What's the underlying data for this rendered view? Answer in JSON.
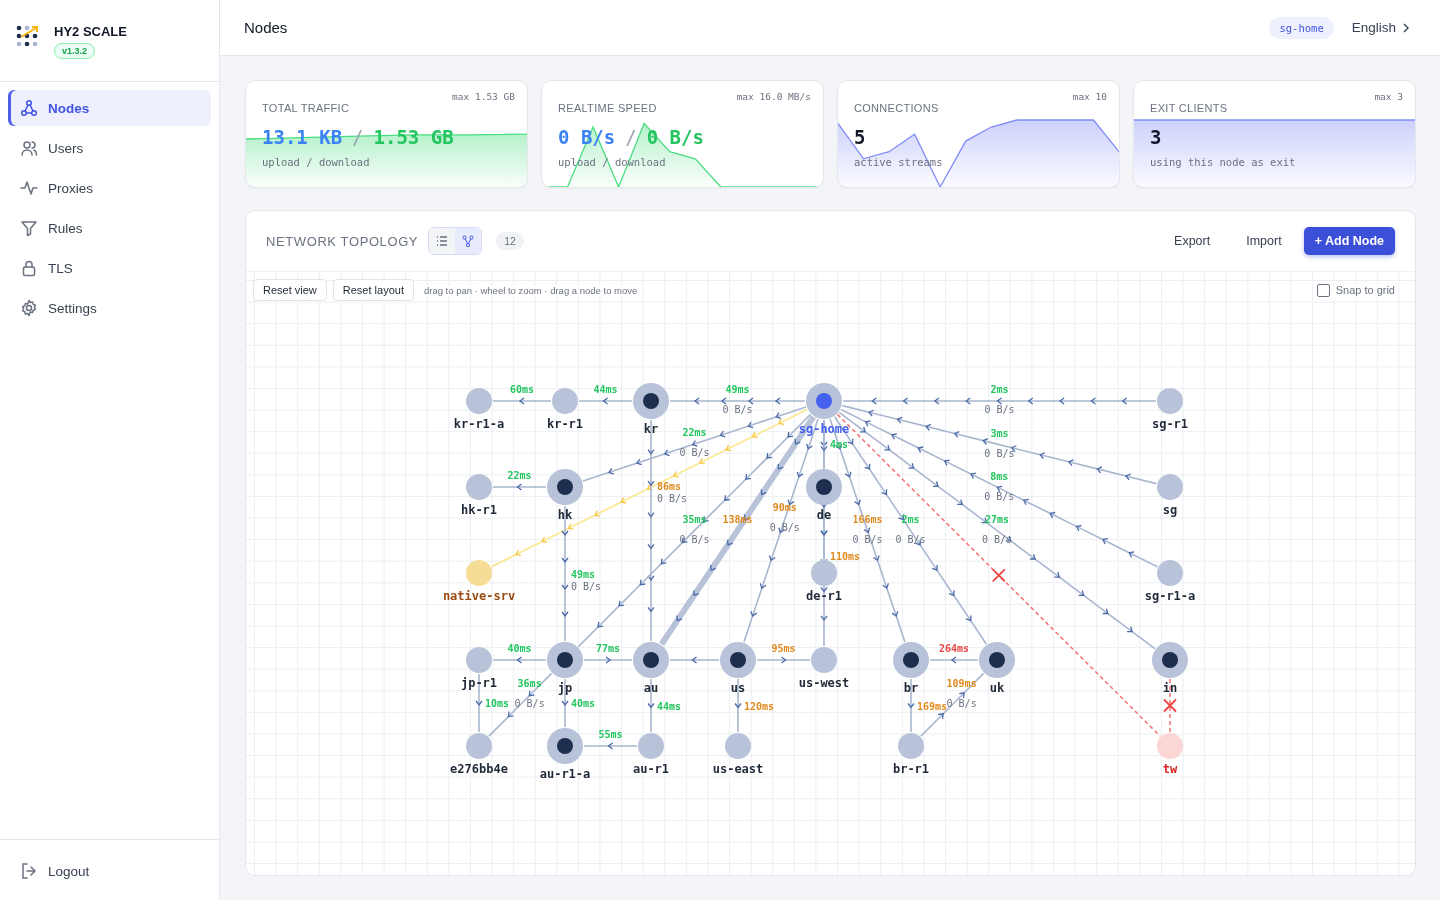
{
  "brand": {
    "name": "HY2 SCALE",
    "version": "v1.3.2"
  },
  "nav": [
    {
      "label": "Nodes",
      "selected": true
    },
    {
      "label": "Users",
      "selected": false
    },
    {
      "label": "Proxies",
      "selected": false
    },
    {
      "label": "Rules",
      "selected": false
    },
    {
      "label": "TLS",
      "selected": false
    },
    {
      "label": "Settings",
      "selected": false
    }
  ],
  "logout": "Logout",
  "header": {
    "title": "Nodes",
    "node_badge": "sg-home",
    "language": "English"
  },
  "stats": [
    {
      "title": "TOTAL TRAFFIC",
      "max": "max 1.53 GB",
      "primary": "13.1 KB",
      "separator": "/",
      "secondary": "1.53 GB",
      "caption": "upload / download"
    },
    {
      "title": "REALTIME SPEED",
      "max": "max 16.0 MB/s",
      "primary": "0 B/s",
      "separator": "/",
      "secondary": "0 B/s",
      "caption": "upload / download"
    },
    {
      "title": "CONNECTIONS",
      "max": "max 10",
      "primary": "5",
      "caption": "active streams"
    },
    {
      "title": "EXIT CLIENTS",
      "max": "max 3",
      "primary": "3",
      "caption": "using this node as exit"
    }
  ],
  "topology": {
    "title": "NETWORK TOPOLOGY",
    "views": [
      {
        "kind": "list",
        "selected": false
      },
      {
        "kind": "graph",
        "selected": true
      }
    ],
    "count": "12",
    "actions": [
      "Export",
      "Import"
    ],
    "add_button": "+ Add Node",
    "tools": [
      "Reset view",
      "Reset layout"
    ],
    "hint": "drag to pan · wheel to zoom · drag a node to move",
    "snap": {
      "label": "Snap to grid",
      "checked": false
    },
    "nodes": [
      {
        "name": "kr-r1-a",
        "kind": "leaf"
      },
      {
        "name": "kr-r1",
        "kind": "leaf"
      },
      {
        "name": "kr",
        "kind": "relay"
      },
      {
        "name": "sg-home",
        "kind": "home"
      },
      {
        "name": "sg-r1",
        "kind": "leaf"
      },
      {
        "name": "hk-r1",
        "kind": "leaf"
      },
      {
        "name": "hk",
        "kind": "relay"
      },
      {
        "name": "de",
        "kind": "relay"
      },
      {
        "name": "sg",
        "kind": "leaf"
      },
      {
        "name": "native-srv",
        "kind": "native"
      },
      {
        "name": "de-r1",
        "kind": "leaf"
      },
      {
        "name": "sg-r1-a",
        "kind": "leaf"
      },
      {
        "name": "jp-r1",
        "kind": "leaf"
      },
      {
        "name": "jp",
        "kind": "relay"
      },
      {
        "name": "au",
        "kind": "relay"
      },
      {
        "name": "us",
        "kind": "relay"
      },
      {
        "name": "us-west",
        "kind": "leaf"
      },
      {
        "name": "br",
        "kind": "relay"
      },
      {
        "name": "uk",
        "kind": "relay"
      },
      {
        "name": "in",
        "kind": "relay"
      },
      {
        "name": "e276bb4e",
        "kind": "leaf"
      },
      {
        "name": "au-r1-a",
        "kind": "relay"
      },
      {
        "name": "au-r1",
        "kind": "leaf"
      },
      {
        "name": "us-east",
        "kind": "leaf"
      },
      {
        "name": "br-r1",
        "kind": "leaf"
      },
      {
        "name": "tw",
        "kind": "offline"
      }
    ],
    "edges": [
      {
        "kind": "link",
        "latency": "60ms",
        "color": "#22c55e"
      },
      {
        "kind": "link",
        "latency": "44ms",
        "color": "#22c55e"
      },
      {
        "kind": "link",
        "latency": "49ms",
        "color": "#22c55e",
        "rate": "0 B/s"
      },
      {
        "kind": "link",
        "latency": "2ms",
        "color": "#22c55e",
        "rate": "0 B/s"
      },
      {
        "kind": "link",
        "latency": "22ms",
        "color": "#22c55e",
        "rate": "0 B/s"
      },
      {
        "kind": "link",
        "latency": "4ms",
        "color": "#22c55e"
      },
      {
        "kind": "link",
        "latency": "3ms",
        "color": "#22c55e",
        "rate": "0 B/s"
      },
      {
        "kind": "link",
        "latency": "22ms",
        "color": "#22c55e"
      },
      {
        "kind": "native"
      },
      {
        "kind": "link",
        "latency": "86ms",
        "color": "#e08a1e",
        "rate": "0 B/s"
      },
      {
        "kind": "link",
        "latency": "8ms",
        "color": "#22c55e",
        "rate": "0 B/s"
      },
      {
        "kind": "link"
      },
      {
        "kind": "link",
        "latency": "35ms",
        "color": "#22c55e",
        "rate": "0 B/s"
      },
      {
        "kind": "thick",
        "latency": "138ms",
        "color": "#e08a1e"
      },
      {
        "kind": "link",
        "latency": "90ms",
        "color": "#e08a1e",
        "rate": "0 B/s"
      },
      {
        "kind": "link",
        "latency": "110ms",
        "color": "#e08a1e"
      },
      {
        "kind": "link",
        "latency": "166ms",
        "color": "#e08a1e",
        "rate": "0 B/s"
      },
      {
        "kind": "link",
        "latency": "2ms",
        "color": "#22c55e",
        "rate": "0 B/s"
      },
      {
        "kind": "link",
        "latency": "27ms",
        "color": "#22c55e",
        "rate": "0 B/s"
      },
      {
        "kind": "link",
        "latency": "49ms",
        "color": "#22c55e",
        "rate": "0 B/s"
      },
      {
        "kind": "broken"
      },
      {
        "kind": "link",
        "latency": "40ms",
        "color": "#22c55e"
      },
      {
        "kind": "link",
        "latency": "77ms",
        "color": "#22c55e"
      },
      {
        "kind": "link"
      },
      {
        "kind": "link",
        "latency": "95ms",
        "color": "#e08a1e"
      },
      {
        "kind": "link",
        "latency": "264ms",
        "color": "#ef4444"
      },
      {
        "kind": "link",
        "latency": "10ms",
        "color": "#22c55e"
      },
      {
        "kind": "link",
        "latency": "36ms",
        "color": "#22c55e",
        "rate": "0 B/s"
      },
      {
        "kind": "link",
        "latency": "40ms",
        "color": "#22c55e"
      },
      {
        "kind": "link",
        "latency": "44ms",
        "color": "#22c55e"
      },
      {
        "kind": "link",
        "latency": "120ms",
        "color": "#e08a1e"
      },
      {
        "kind": "link",
        "latency": "169ms",
        "color": "#e08a1e"
      },
      {
        "kind": "link",
        "latency": "109ms",
        "color": "#e08a1e",
        "rate": "0 B/s"
      },
      {
        "kind": "broken"
      },
      {
        "kind": "link",
        "latency": "55ms",
        "color": "#22c55e"
      }
    ]
  }
}
